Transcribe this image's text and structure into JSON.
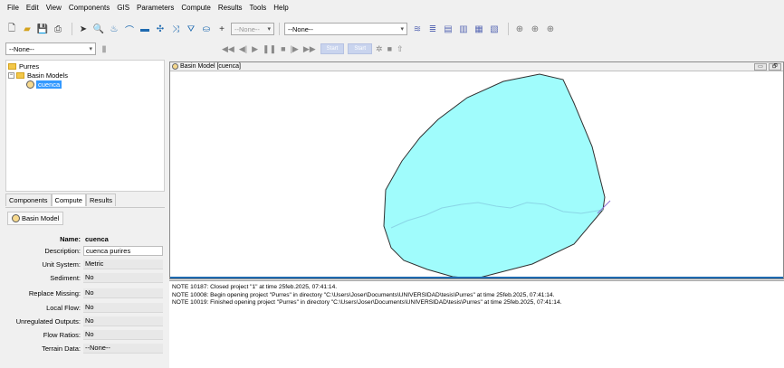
{
  "menu": [
    "File",
    "Edit",
    "View",
    "Components",
    "GIS",
    "Parameters",
    "Compute",
    "Results",
    "Tools",
    "Help"
  ],
  "toolbar": {
    "run_combo": "--None--",
    "meteo_combo": "--None--",
    "element_combo": "--None--",
    "anim_btn1": "Start",
    "anim_btn2": "Start"
  },
  "tree": {
    "root": "Purres",
    "folder": "Basin Models",
    "selected": "cuenca"
  },
  "tabs": [
    "Components",
    "Compute",
    "Results"
  ],
  "props": {
    "header": "Basin Model",
    "rows": [
      {
        "label": "Name:",
        "value": "cuenca"
      },
      {
        "label": "Description:",
        "value": "cuenca purires"
      },
      {
        "label": "Unit System:",
        "value": "Metric"
      },
      {
        "label": "Sediment:",
        "value": "No"
      },
      {
        "label": "Replace Missing:",
        "value": "No"
      },
      {
        "label": "Local Flow:",
        "value": "No"
      },
      {
        "label": "Unregulated Outputs:",
        "value": "No"
      },
      {
        "label": "Flow Ratios:",
        "value": "No"
      },
      {
        "label": "Terrain Data:",
        "value": "--None--"
      }
    ]
  },
  "basin_window": {
    "title": "Basin Model [cuenca]",
    "fill_color": "#a0fcfc",
    "outline_color": "#303030"
  },
  "log": [
    "NOTE 10187:  Closed project \"1\" at time 25feb.2025, 07:41:14.",
    "NOTE 10008:  Begin opening project \"Purres\" in directory \"C:\\Users\\Joser\\Documents\\UNIVERSIDAD\\tesis\\Purres\" at time 25feb.2025, 07:41:14.",
    "NOTE 10019:  Finished opening project \"Purres\" in directory \"C:\\Users\\Joser\\Documents\\UNIVERSIDAD\\tesis\\Purres\" at time 25feb.2025, 07:41:14."
  ]
}
